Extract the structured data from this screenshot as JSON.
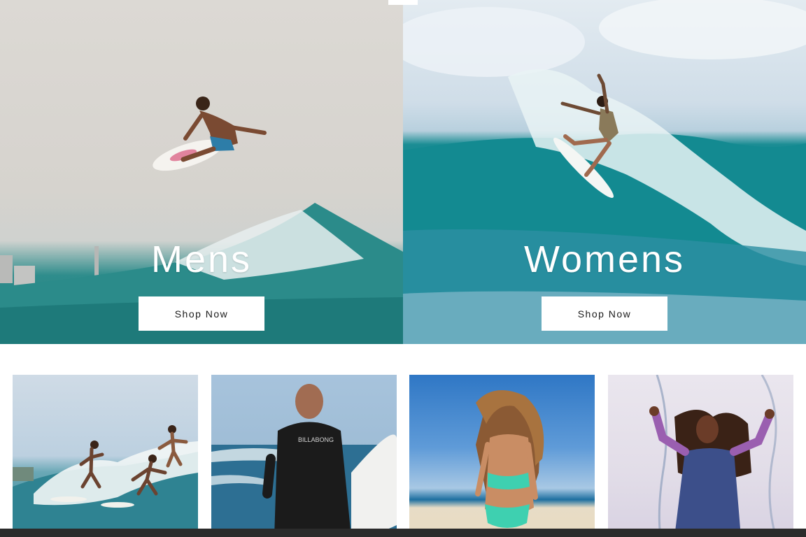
{
  "hero": {
    "mens": {
      "title": "Mens",
      "button_label": "Shop Now"
    },
    "womens": {
      "title": "Womens",
      "button_label": "Shop Now"
    }
  },
  "tiles": [
    {
      "name": "surfers-group"
    },
    {
      "name": "wetsuit-surfboard"
    },
    {
      "name": "bikini-beach"
    },
    {
      "name": "splash-wetsuit"
    }
  ]
}
